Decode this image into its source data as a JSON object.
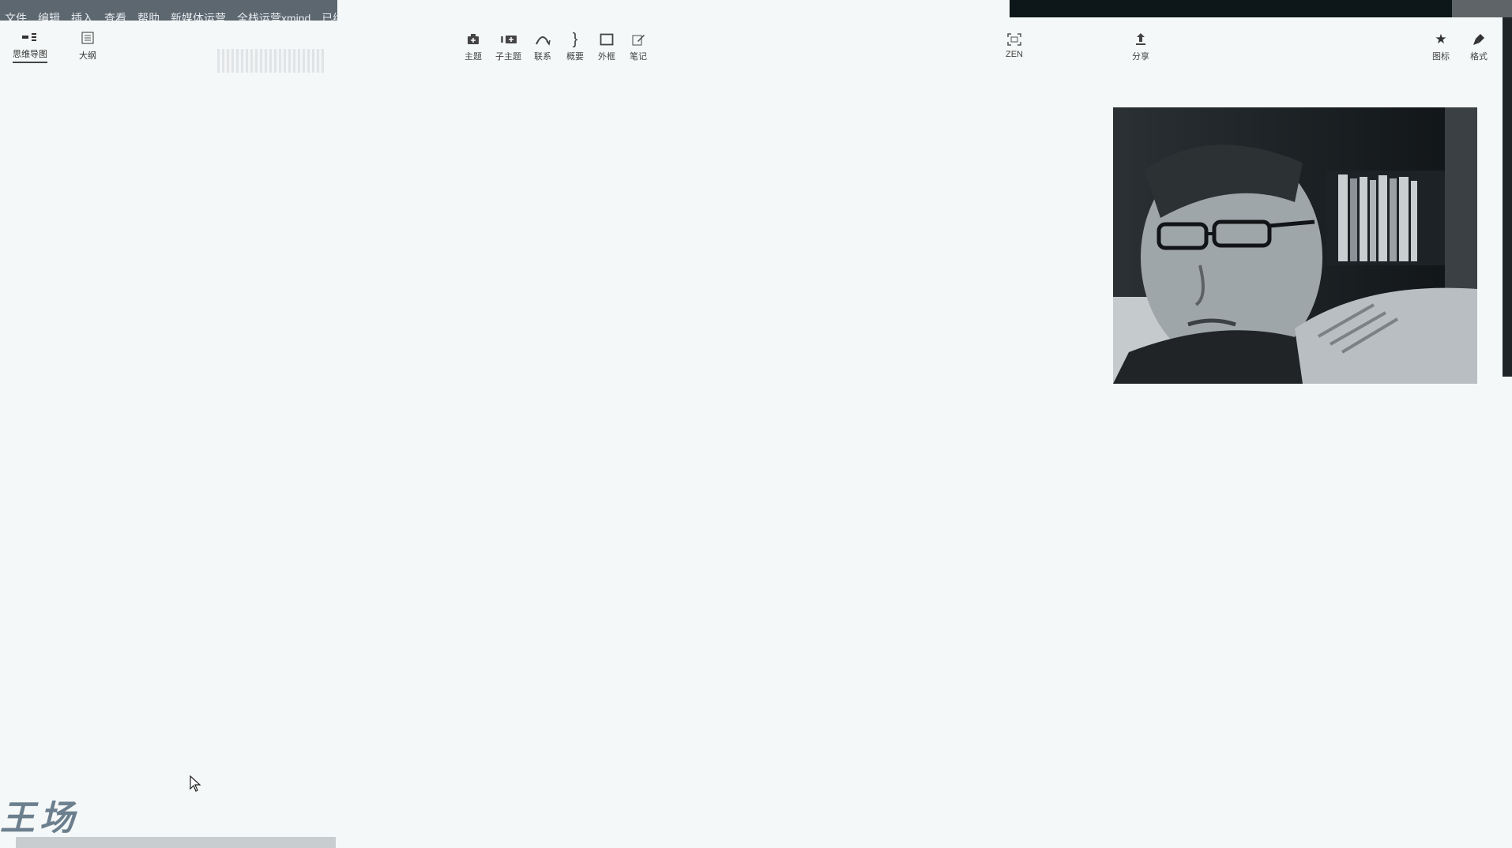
{
  "menubar": {
    "items": [
      "文件",
      "编辑",
      "插入",
      "查看",
      "帮助",
      "新媒体运营",
      "全栈运营xmind",
      "已编辑"
    ]
  },
  "view_tabs": [
    {
      "label": "思维导图",
      "icon": "mindmap-icon",
      "active": true
    },
    {
      "label": "大纲",
      "icon": "outline-icon",
      "active": false
    }
  ],
  "toolbar": {
    "topic": "主题",
    "subtopic": "子主题",
    "relationship": "联系",
    "summary": "概要",
    "boundary": "外框",
    "note": "笔记",
    "zen": "ZEN",
    "share": "分享",
    "icon_panel": "图标",
    "format": "格式"
  },
  "watermark": {
    "text": "王场"
  }
}
